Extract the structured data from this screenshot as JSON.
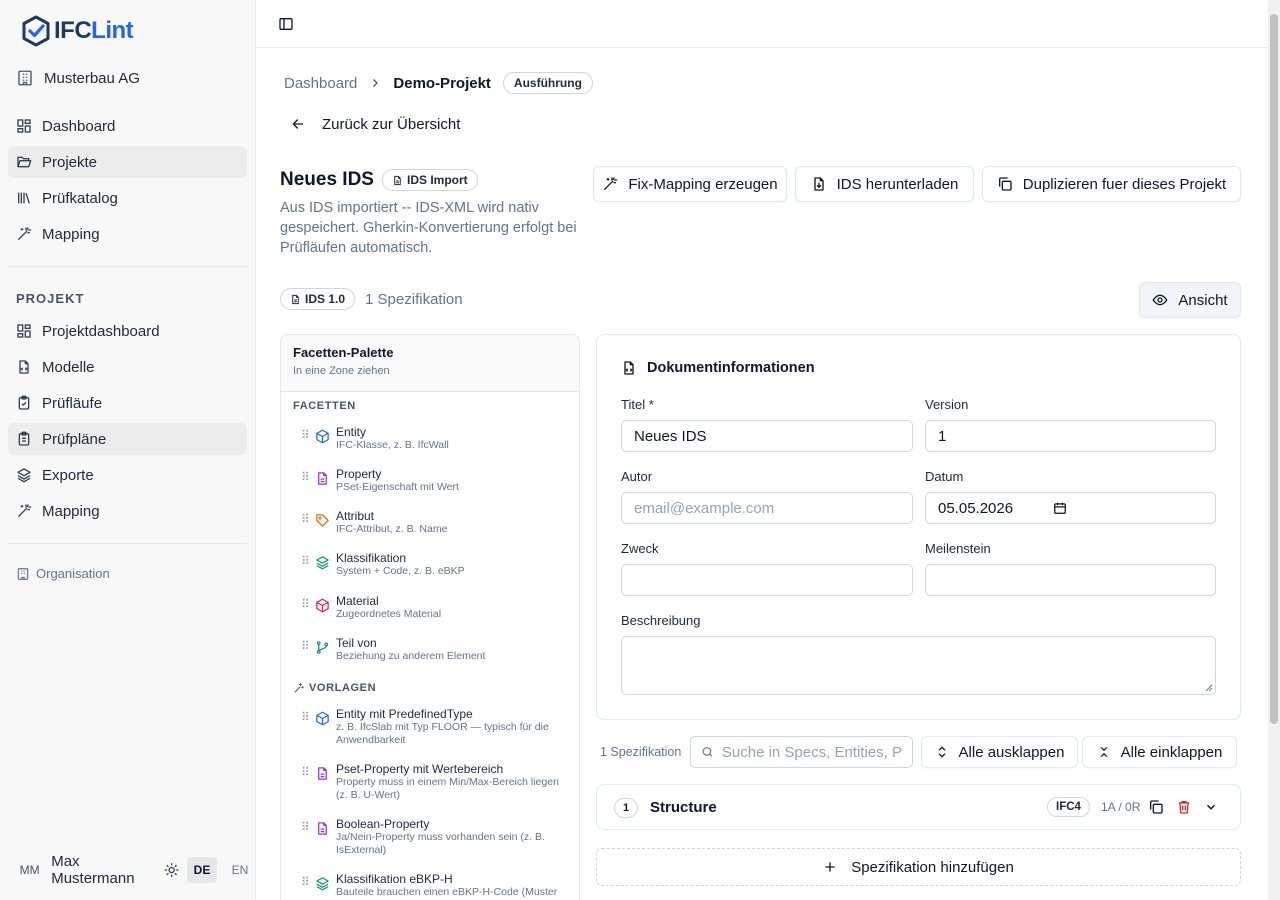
{
  "app": {
    "brand_a": "IFC",
    "brand_b": "Lint",
    "brand_color": "#1e3a5f",
    "accent": "#2563eb"
  },
  "sidebar": {
    "org": "Musterbau AG",
    "main_nav": [
      {
        "label": "Dashboard",
        "icon": "grid-icon"
      },
      {
        "label": "Projekte",
        "icon": "folder-open-icon",
        "active": true
      },
      {
        "label": "Prüfkatalog",
        "icon": "library-icon"
      },
      {
        "label": "Mapping",
        "icon": "magic-wand-icon"
      }
    ],
    "section_label": "PROJEKT",
    "project_nav": [
      {
        "label": "Projektdashboard",
        "icon": "grid-icon"
      },
      {
        "label": "Modelle",
        "icon": "file-code-icon"
      },
      {
        "label": "Prüfläufe",
        "icon": "clipboard-check-icon"
      },
      {
        "label": "Prüfpläne",
        "icon": "clipboard-list-icon",
        "active": true
      },
      {
        "label": "Exporte",
        "icon": "layers-icon"
      },
      {
        "label": "Mapping",
        "icon": "magic-wand-icon"
      }
    ],
    "organisation_link": "Organisation",
    "user": {
      "initials": "MM",
      "name": "Max Mustermann"
    },
    "lang": {
      "de": "DE",
      "en": "EN"
    }
  },
  "breadcrumb": {
    "root": "Dashboard",
    "current": "Demo-Projekt",
    "phase": "Ausführung"
  },
  "back_label": "Zurück zur Übersicht",
  "header": {
    "title": "Neues IDS",
    "badge": "IDS Import",
    "description": "Aus IDS importiert -- IDS-XML wird nativ gespeichert. Gherkin-Konvertierung erfolgt bei Prüfläufen automatisch."
  },
  "actions": {
    "fix_mapping": "Fix-Mapping erzeugen",
    "download": "IDS herunterladen",
    "duplicate": "Duplizieren fuer dieses Projekt",
    "view": "Ansicht"
  },
  "meta": {
    "ids_version": "IDS 1.0",
    "spec_count": "1 Spezifikation"
  },
  "palette": {
    "title": "Facetten-Palette",
    "subtitle": "In eine Zone ziehen",
    "facets_label": "FACETTEN",
    "facets": [
      {
        "name": "Entity",
        "desc": "IFC-Klasse, z. B. IfcWall",
        "icon": "cube-icon",
        "color": "#2563eb"
      },
      {
        "name": "Property",
        "desc": "PSet-Eigenschaft mit Wert",
        "icon": "document-icon",
        "color": "#9333ea"
      },
      {
        "name": "Attribut",
        "desc": "IFC-Attribut, z. B. Name",
        "icon": "tag-icon",
        "color": "#d97706"
      },
      {
        "name": "Klassifikation",
        "desc": "System + Code, z. B. eBKP",
        "icon": "layers-icon",
        "color": "#059669"
      },
      {
        "name": "Material",
        "desc": "Zugeordnetes Material",
        "icon": "cube-icon",
        "color": "#e11d48"
      },
      {
        "name": "Teil von",
        "desc": "Beziehung zu anderem Element",
        "icon": "git-branch-icon",
        "color": "#0d9488"
      }
    ],
    "templates_label": "VORLAGEN",
    "templates": [
      {
        "name": "Entity mit PredefinedType",
        "desc": "z. B. IfcSlab mit Typ FLOOR — typisch für die Anwendbarkeit",
        "icon": "cube-icon",
        "color": "#2563eb"
      },
      {
        "name": "Pset-Property mit Wertebereich",
        "desc": "Property muss in einem Min/Max-Bereich liegen (z. B. U-Wert)",
        "icon": "document-icon",
        "color": "#9333ea"
      },
      {
        "name": "Boolean-Property",
        "desc": "Ja/Nein-Property muss vorhanden sein (z. B. IsExternal)",
        "icon": "document-icon",
        "color": "#9333ea"
      },
      {
        "name": "Klassifikation eBKP-H",
        "desc": "Bauteile brauchen einen eBKP-H-Code (Muster",
        "icon": "layers-icon",
        "color": "#059669"
      }
    ]
  },
  "docinfo": {
    "heading": "Dokumentinformationen",
    "title_label": "Titel *",
    "title_value": "Neues IDS",
    "version_label": "Version",
    "version_value": "1",
    "author_label": "Autor",
    "author_placeholder": "email@example.com",
    "date_label": "Datum",
    "date_value": "05.05.2026",
    "purpose_label": "Zweck",
    "milestone_label": "Meilenstein",
    "description_label": "Beschreibung"
  },
  "specs": {
    "count": "1 Spezifikation",
    "search_placeholder": "Suche in Specs, Entities, P",
    "expand_all": "Alle ausklappen",
    "collapse_all": "Alle einklappen",
    "items": [
      {
        "number": "1",
        "name": "Structure",
        "schema": "IFC4",
        "counts": "1A / 0R"
      }
    ],
    "add_label": "Spezifikation hinzufügen"
  }
}
